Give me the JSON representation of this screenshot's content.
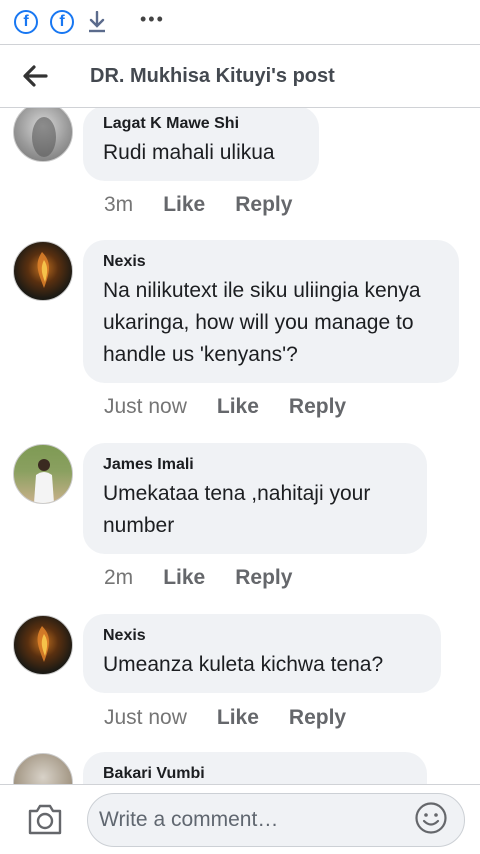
{
  "header": {
    "title": "DR. Mukhisa Kituyi's post",
    "fb_icon_glyph": "f"
  },
  "statusbar": {
    "icons": [
      "facebook-icon",
      "facebook-icon",
      "download-icon",
      "more-dots-icon"
    ],
    "dots": "•••"
  },
  "comments": [
    {
      "author": "Lagat K Mawe Shi",
      "text": "Rudi mahali ulikua",
      "time": "3m",
      "like": "Like",
      "reply": "Reply"
    },
    {
      "author": "Nexis",
      "text": "Na nilikutext ile siku uliingia kenya ukaringa, how will you manage to handle us 'kenyans'?",
      "time": "Just now",
      "like": "Like",
      "reply": "Reply"
    },
    {
      "author": "James Imali",
      "text": "Umekataa tena ,nahitaji your number",
      "time": "2m",
      "like": "Like",
      "reply": "Reply"
    },
    {
      "author": "Nexis",
      "text": "Umeanza kuleta kichwa tena?",
      "time": "Just now",
      "like": "Like",
      "reply": "Reply"
    },
    {
      "author": "Bakari Vumbi"
    }
  ],
  "composer": {
    "placeholder": "Write a comment…"
  },
  "colors": {
    "brand": "#1877f2",
    "bubble": "#f0f2f5",
    "meta_text": "#65676b"
  }
}
